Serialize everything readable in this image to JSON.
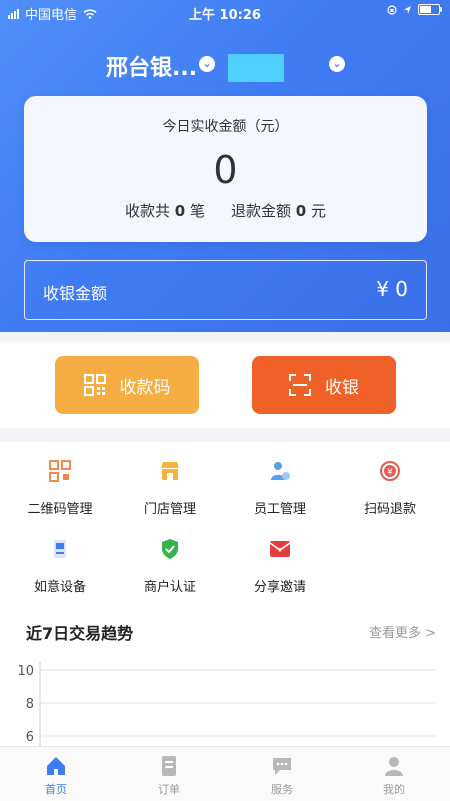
{
  "status": {
    "carrier": "中国电信",
    "time": "上午 10:26"
  },
  "header": {
    "store_name": "邢台银...",
    "dropdown_icon": "chevron-down-icon"
  },
  "summary": {
    "label": "今日实收金额（元）",
    "amount": "0",
    "count_label": "收款共",
    "count_value": "0",
    "count_unit": "笔",
    "refund_label": "退款金额",
    "refund_value": "0",
    "refund_unit": "元"
  },
  "amount_input": {
    "label": "收银金额",
    "value": "¥ 0"
  },
  "actions": [
    {
      "label": "收款码",
      "icon": "qr-code-icon",
      "color": "#f5ad44"
    },
    {
      "label": "收银",
      "icon": "scan-icon",
      "color": "#f06127"
    }
  ],
  "functions": [
    {
      "label": "二维码管理",
      "icon": "qr-manage-icon",
      "color": "#f08a4b"
    },
    {
      "label": "门店管理",
      "icon": "store-icon",
      "color": "#f3b33d"
    },
    {
      "label": "员工管理",
      "icon": "staff-icon",
      "color": "#5aa0e8"
    },
    {
      "label": "扫码退款",
      "icon": "refund-icon",
      "color": "#e55b52"
    },
    {
      "label": "如意设备",
      "icon": "device-icon",
      "color": "#3f7cf3"
    },
    {
      "label": "商户认证",
      "icon": "shield-check-icon",
      "color": "#34b34a"
    },
    {
      "label": "分享邀请",
      "icon": "envelope-icon",
      "color": "#e43d3d"
    }
  ],
  "trend": {
    "title": "近7日交易趋势",
    "more": "查看更多 >"
  },
  "chart_data": {
    "type": "line",
    "title": "",
    "ytick_labels": [
      "10",
      "8",
      "6"
    ],
    "ylim": [
      6,
      10
    ],
    "grid": true
  },
  "tabs": [
    {
      "label": "首页",
      "icon": "home-icon",
      "active": true
    },
    {
      "label": "订单",
      "icon": "order-icon",
      "active": false
    },
    {
      "label": "服务",
      "icon": "service-icon",
      "active": false
    },
    {
      "label": "我的",
      "icon": "profile-icon",
      "active": false
    }
  ],
  "colors": {
    "primary": "#3f7cf3",
    "orange": "#f5ad44",
    "red_orange": "#f06127"
  }
}
